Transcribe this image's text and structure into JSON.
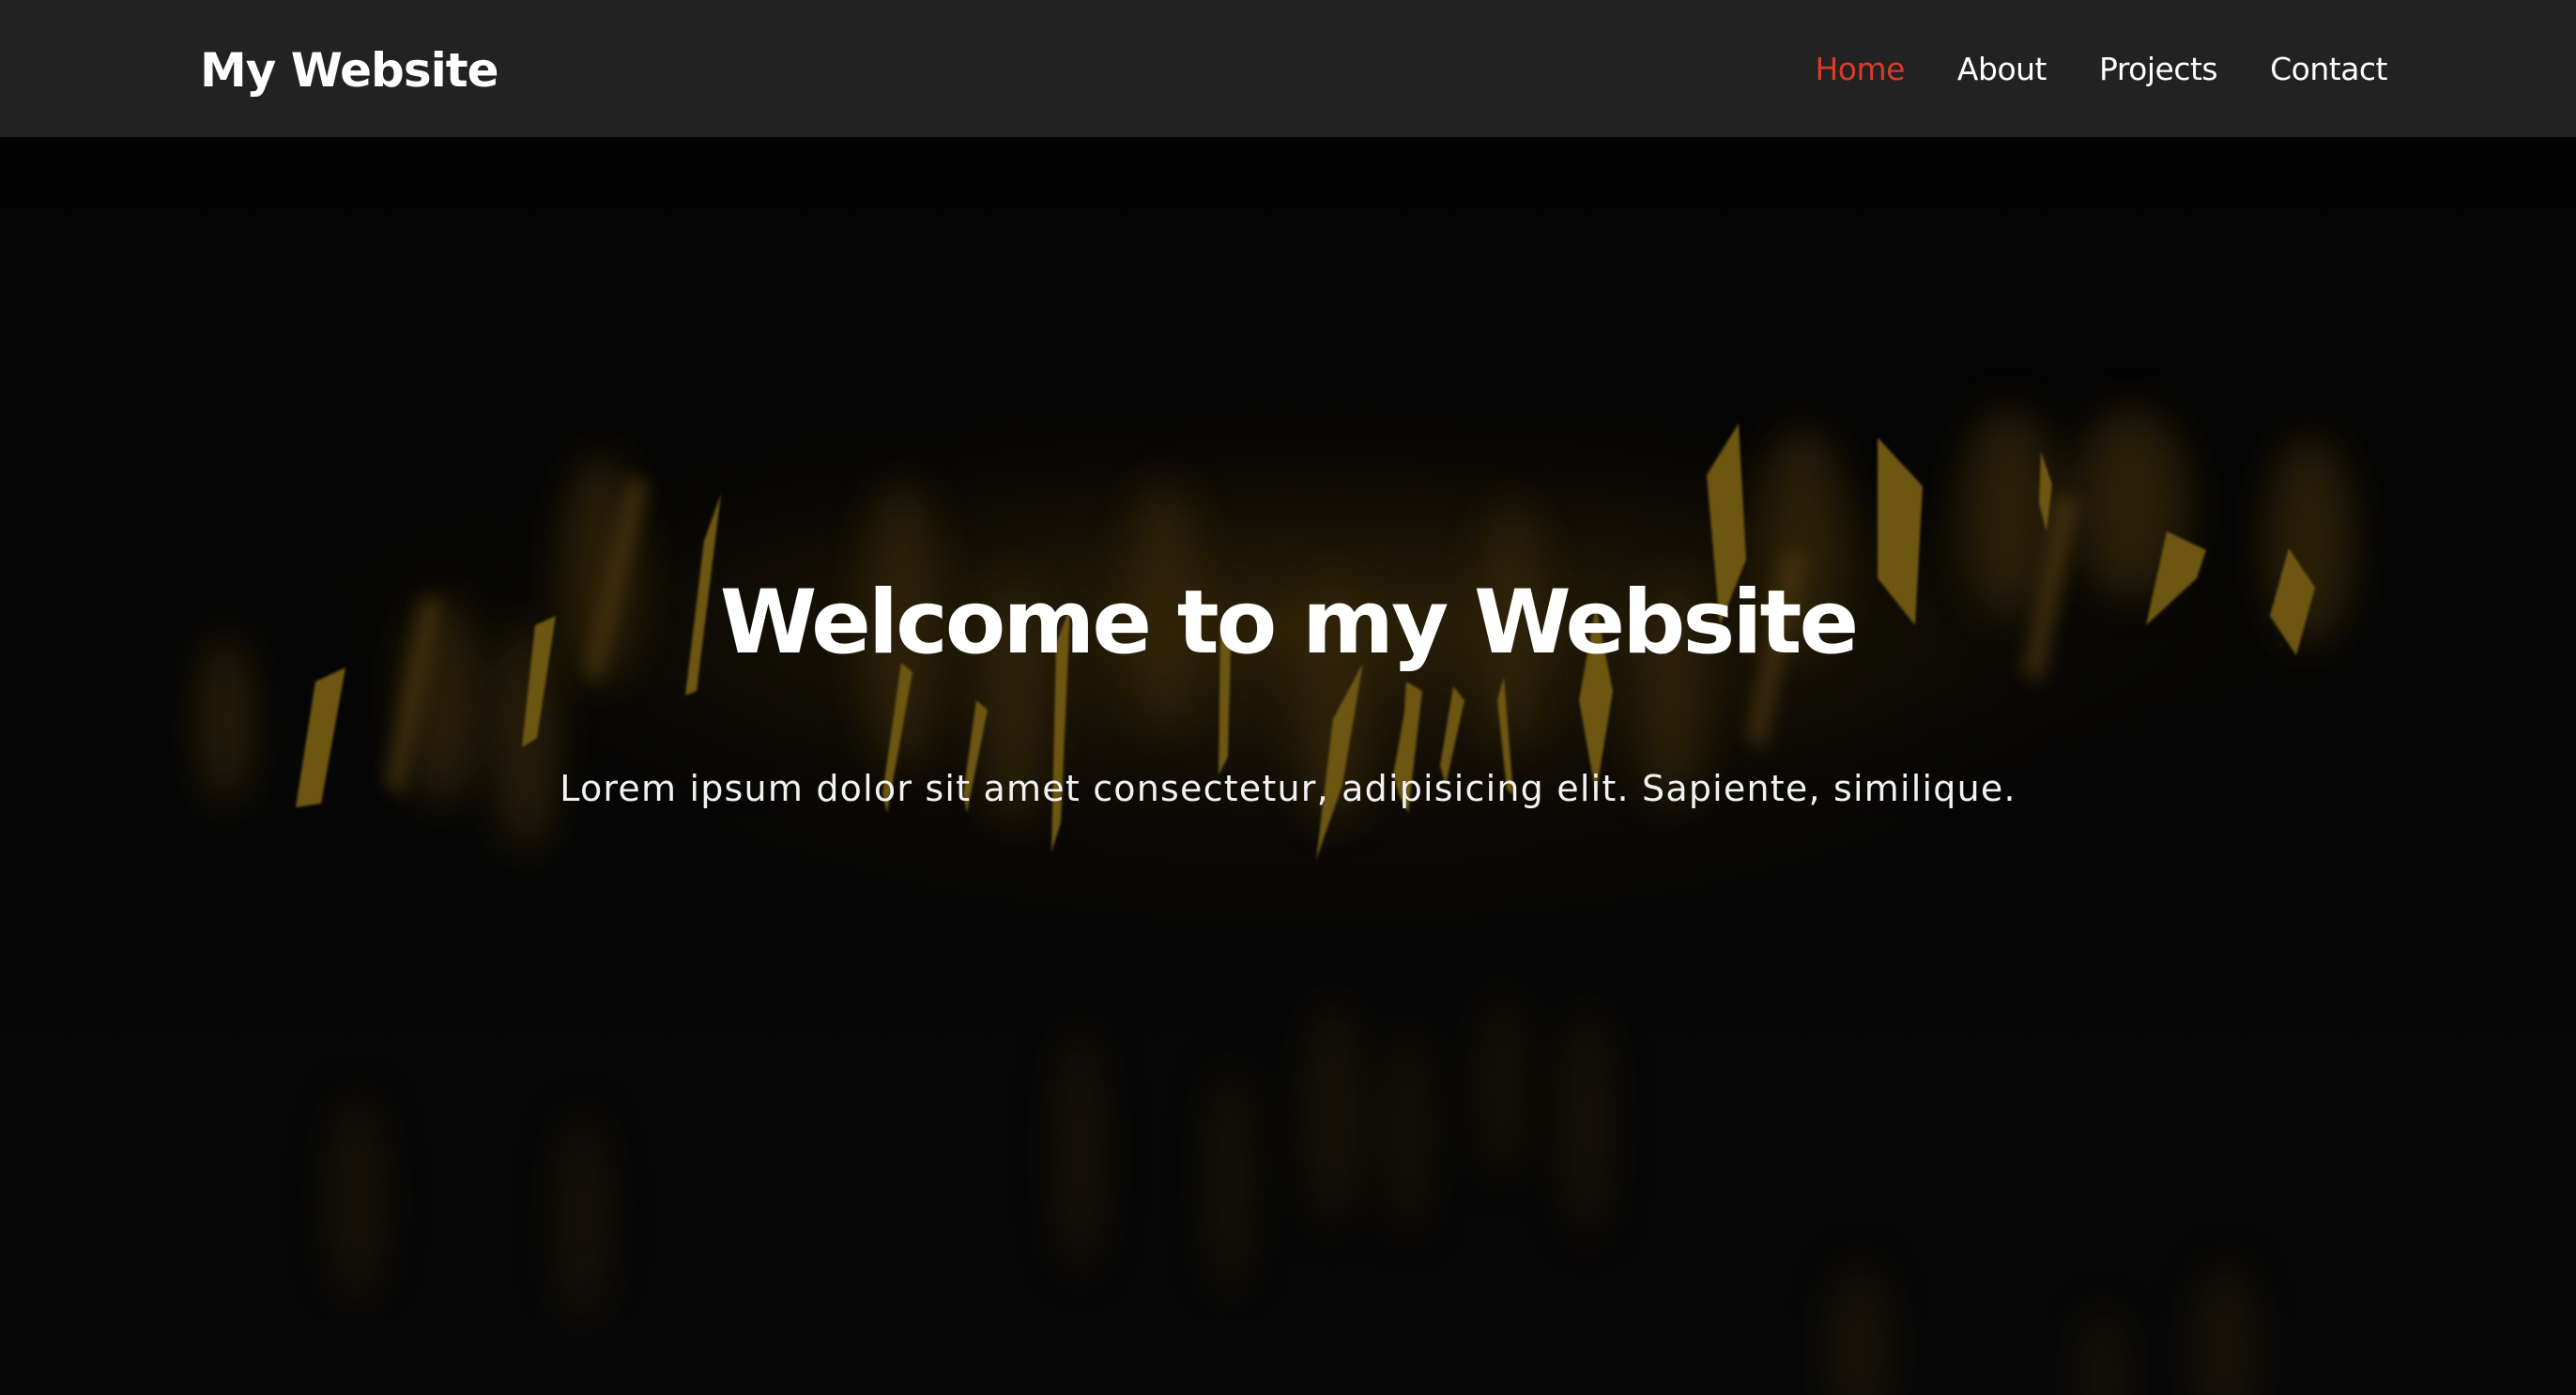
{
  "header": {
    "brand": "My Website",
    "nav": [
      {
        "label": "Home",
        "active": true
      },
      {
        "label": "About",
        "active": false
      },
      {
        "label": "Projects",
        "active": false
      },
      {
        "label": "Contact",
        "active": false
      }
    ]
  },
  "hero": {
    "title": "Welcome to my Website",
    "subtitle": "Lorem ipsum dolor sit amet consectetur, adipisicing elit. Sapiente, similique."
  },
  "colors": {
    "navbar_background": "#222222",
    "active_link": "#d93b2b",
    "hero_background": "#060606",
    "accent_gold": "#a8851e"
  }
}
